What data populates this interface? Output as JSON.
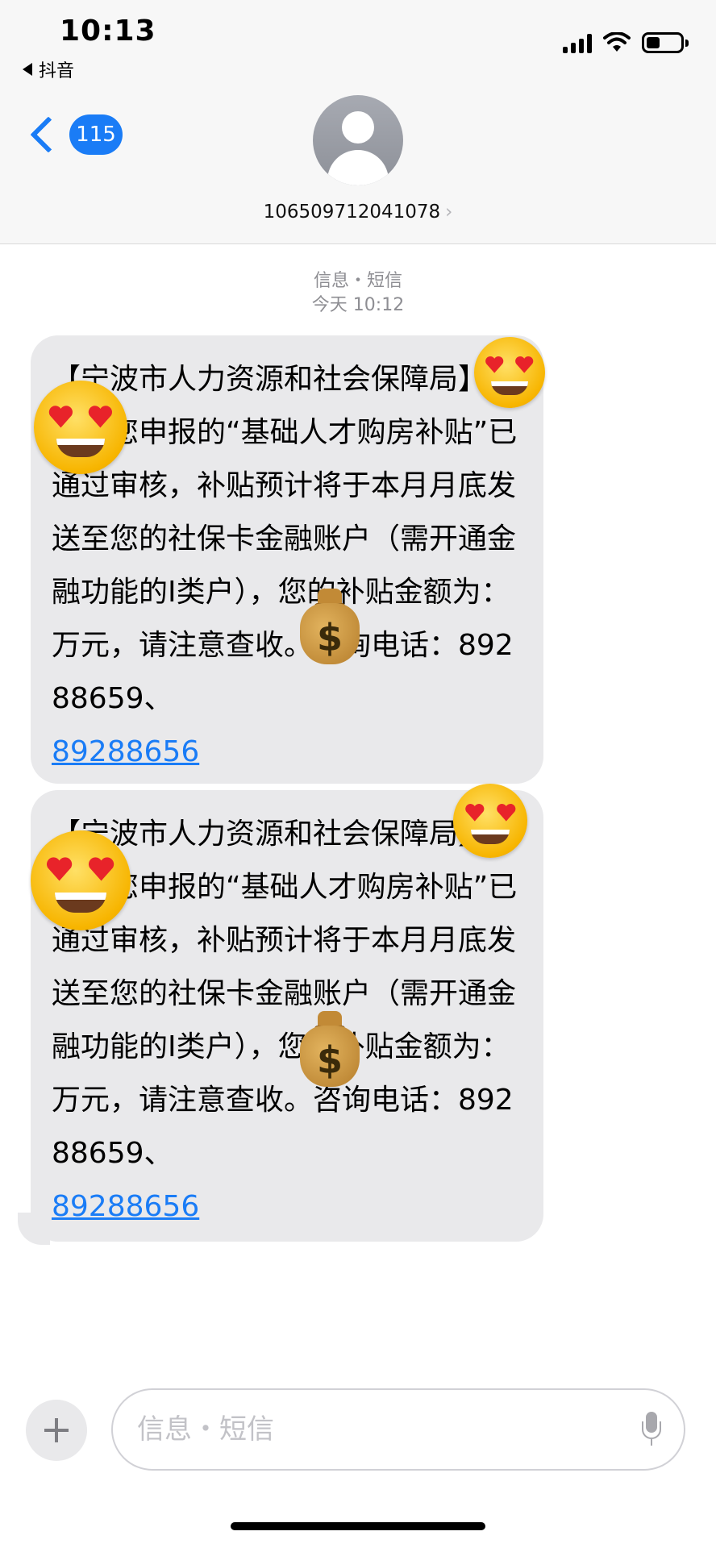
{
  "status_bar": {
    "time": "10:13",
    "back_app": "抖音",
    "battery_level": 0.4
  },
  "header": {
    "back_badge": "115",
    "contact": "106509712041078",
    "contact_caret": "›"
  },
  "thread": {
    "service_time": [
      "信息・短信",
      "今天 10:12"
    ],
    "messages": [
      {
        "text": "【宁波市人力资源和社会保障局】您好！您申报的“基础人才购房补贴”已通过审核，补贴预计将于本月月底发送至您的社保卡金融账户（需开通金融功能的I类户），您的补贴金额为：  万元，请注意查收。咨询电话：89288659、",
        "link": "89288656"
      },
      {
        "text": "【宁波市人力资源和社会保障局】您好！您申报的“基础人才购房补贴”已通过审核，补贴预计将于本月月底发送至您的社保卡金融账户（需开通金融功能的I类户），您的补贴金额为：  万元，请注意查收。咨询电话：89288659、",
        "link": "89288656"
      }
    ]
  },
  "stickers": {
    "heart_eyes": "heart-eyes-emoji",
    "money_bag": "money-bag-emoji",
    "money_symbol": "$"
  },
  "composer": {
    "placeholder": "信息・短信"
  },
  "colors": {
    "accent": "#1a7cf6",
    "bubble": "#e9e9eb",
    "header_bg": "#f7f7f7"
  }
}
